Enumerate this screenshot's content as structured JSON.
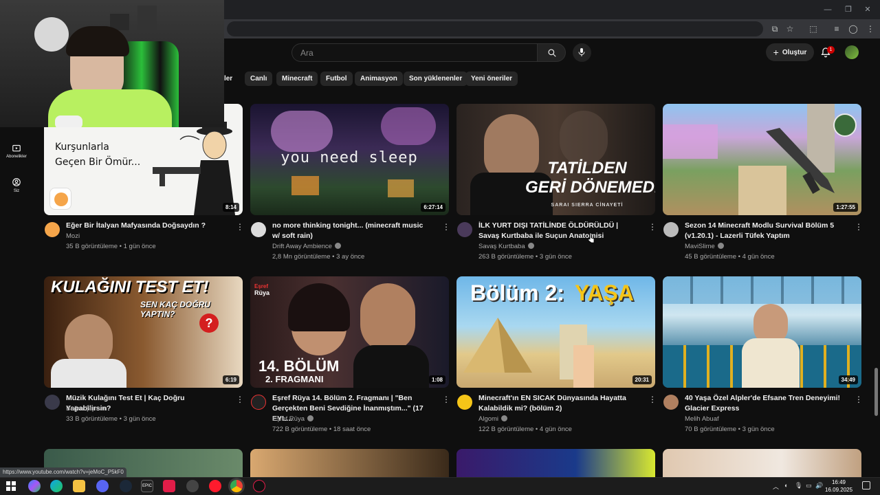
{
  "search": {
    "placeholder": "Ara"
  },
  "header": {
    "create_label": "Oluştur",
    "notifications_count": "1"
  },
  "chips": [
    "k'ler",
    "Canlı",
    "Minecraft",
    "Futbol",
    "Animasyon",
    "Son yüklenenler",
    "Yeni öneriler"
  ],
  "sidebar": {
    "items": [
      {
        "label": "Abonelikler"
      },
      {
        "label": "Siz"
      }
    ]
  },
  "webcam": {
    "thumb_text": "Kurşunlarla\nGeçen Bir Ömür..."
  },
  "videos": [
    {
      "title": "Eğer Bir İtalyan Mafyasında Doğsaydın ?",
      "channel": "Mozi",
      "views": "35 B görüntüleme",
      "age": "1 gün önce",
      "duration": "8:14",
      "verified": false,
      "thumb_text": "Kurşunlarla\nGeçen Bir Ömür..."
    },
    {
      "title": "no more thinking tonight... (minecraft music w/ soft rain)",
      "channel": "Drift Away Ambience",
      "views": "2,8 Mn görüntüleme",
      "age": "3 ay önce",
      "duration": "6:27:14",
      "verified": true,
      "thumb_text": "you need sleep"
    },
    {
      "title": "İLK YURT DIŞI TATİLİNDE ÖLDÜRÜLDÜ | Savaş Kurtbaba ile Suçun Anatomisi",
      "channel": "Savaş Kurtbaba",
      "views": "263 B görüntüleme",
      "age": "3 gün önce",
      "duration": "",
      "verified": true,
      "thumb_text": "TATİLDEN\nGERİ DÖNEMEDİ",
      "thumb_sub": "SARAI SIERRA CİNAYETİ"
    },
    {
      "title": "Sezon 14 Minecraft Modlu Survival Bölüm 5 (v1.20.1) - Lazerli Tüfek Yaptım",
      "channel": "MaviSlime",
      "views": "45 B görüntüleme",
      "age": "4 gün önce",
      "duration": "1:27:55",
      "verified": true,
      "thumb_text": ""
    },
    {
      "title": "Müzik Kulağını Test Et | Kaç Doğru Yapabilirsin?",
      "channel": "Buğra Şişman",
      "views": "33 B görüntüleme",
      "age": "3 gün önce",
      "duration": "6:19",
      "verified": false,
      "thumb_text": "KULAĞINI TEST ET!",
      "thumb_sub": "SEN KAÇ DOĞRU YAPTIN?"
    },
    {
      "title": "Eşref Rüya 14. Bölüm 2. Fragmanı | \"Ben Gerçekten Beni Sevdiğine İnanmıştım...\" (17 EYL...",
      "channel": "Eşref Rüya",
      "views": "722 B görüntüleme",
      "age": "18 saat önce",
      "duration": "1:08",
      "verified": true,
      "thumb_text": "14. BÖLÜM",
      "thumb_sub": "2. FRAGMANI"
    },
    {
      "title": "Minecraft'ın EN SICAK Dünyasında Hayatta Kalabildik mi? (bölüm 2)",
      "channel": "Algomi",
      "views": "122 B görüntüleme",
      "age": "4 gün önce",
      "duration": "20:31",
      "verified": true,
      "thumb_text": "Bölüm 2:",
      "thumb_sub": "YAŞA"
    },
    {
      "title": "40 Yaşa Özel Alpler'de Efsane Tren Deneyimi! Glacier Express",
      "channel": "Melih Abuaf",
      "views": "70 B görüntüleme",
      "age": "3 gün önce",
      "duration": "34:49",
      "verified": false,
      "thumb_text": ""
    }
  ],
  "status_url": "https://www.youtube.com/watch?v=jeMoC_P5kF0",
  "clock": {
    "time": "16:49",
    "date": "16.09.2025"
  },
  "colors": {
    "background": "#0f0f0f",
    "chip": "#272727",
    "badge": "#cc0000"
  }
}
